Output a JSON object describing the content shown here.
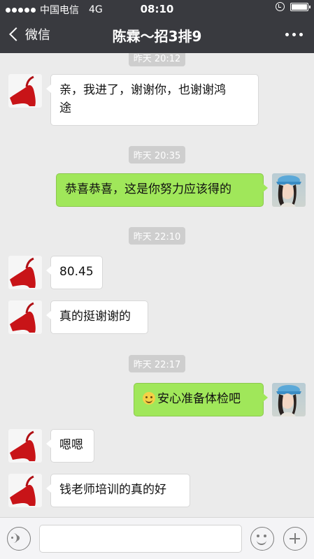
{
  "status_bar": {
    "carrier": "中国电信",
    "network": "4G",
    "time": "08:10"
  },
  "nav": {
    "back_label": "微信",
    "title": "陈霖～招3排9"
  },
  "messages": {
    "ts0": "昨天 20:12",
    "m1": {
      "sender": "contact",
      "text_line1": "亲，我进了，谢谢你，也谢谢鸿",
      "text_line2": "途"
    },
    "ts1": "昨天 20:35",
    "m2": {
      "sender": "me",
      "text": "恭喜恭喜，这是你努力应该得的"
    },
    "ts2": "昨天 22:10",
    "m3": {
      "sender": "contact",
      "text": "80.45"
    },
    "m4": {
      "sender": "contact",
      "text": "真的挺谢谢的"
    },
    "ts3": "昨天 22:17",
    "m5": {
      "sender": "me",
      "text": "安心准备体检吧",
      "emoji": "smiling-face-emoji"
    },
    "m6": {
      "sender": "contact",
      "text": "嗯嗯"
    },
    "m7": {
      "sender": "contact",
      "text": "钱老师培训的真的好"
    }
  },
  "colors": {
    "nav_bg": "#393a3f",
    "chat_bg": "#ebebeb",
    "outgoing_bubble": "#a0e75a",
    "incoming_bubble": "#ffffff"
  },
  "icons": {
    "back": "chevron-left-icon",
    "more": "more-dots-icon",
    "voice": "voice-icon",
    "emoji": "emoji-icon",
    "plus": "plus-icon"
  }
}
